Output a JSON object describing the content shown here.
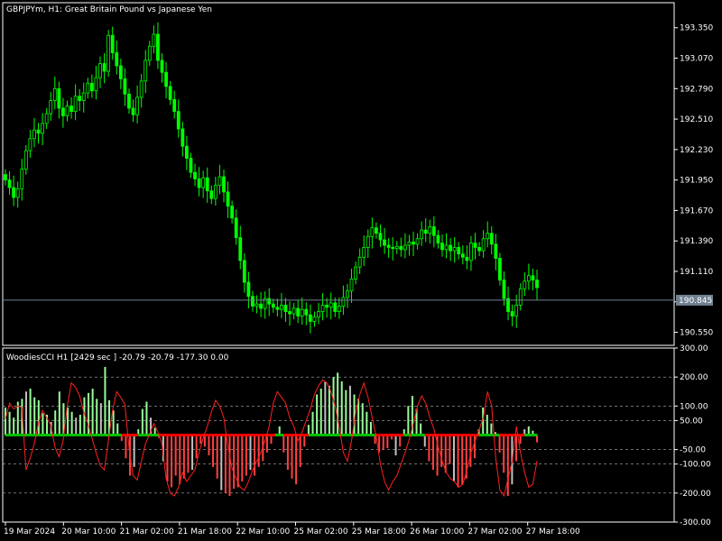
{
  "main_panel": {
    "title": "GBPJPYm, H1:  Great Britain Pound vs Japanese Yen",
    "price_labels": [
      "193.350",
      "193.070",
      "192.790",
      "192.510",
      "192.230",
      "191.950",
      "191.670",
      "191.390",
      "191.110",
      "190.830",
      "190.550"
    ],
    "current_price": "190.845"
  },
  "indicator_panel": {
    "title": "WoodiesCCI H1 [2429 sec ] -20.79 -20.79 -177.30 0.00",
    "level_labels": [
      "300.00",
      "200.00",
      "100.00",
      "50.00",
      "-50.00",
      "-100.00",
      "-200.00",
      "-300.00"
    ]
  },
  "time_axis": {
    "labels": [
      "19 Mar 2024",
      "20 Mar 10:00",
      "21 Mar 02:00",
      "21 Mar 18:00",
      "22 Mar 10:00",
      "25 Mar 02:00",
      "25 Mar 18:00",
      "26 Mar 10:00",
      "27 Mar 02:00",
      "27 Mar 18:00"
    ]
  },
  "colors": {
    "background": "#000000",
    "candle": "#00ff00",
    "axis": "#ffffff",
    "price_line": "#708090",
    "cci_up": "#98fb98",
    "cci_down": "#ff4040",
    "cci_neutral": "#c0c0c0",
    "zero_line_up": "#00c000",
    "zero_line_down": "#ff0000"
  },
  "chart_data": [
    {
      "type": "candlestick",
      "title": "GBPJPYm, H1:  Great Britain Pound vs Japanese Yen",
      "ylim": [
        190.43,
        193.58
      ],
      "current_price": 190.845,
      "close": [
        191.95,
        191.88,
        191.79,
        191.87,
        192.05,
        192.22,
        192.33,
        192.41,
        192.38,
        192.47,
        192.56,
        192.68,
        192.79,
        192.61,
        192.54,
        192.63,
        192.58,
        192.72,
        192.68,
        192.75,
        192.84,
        192.77,
        192.89,
        193.02,
        192.95,
        193.28,
        193.12,
        193.0,
        192.88,
        192.74,
        192.61,
        192.55,
        192.71,
        192.86,
        193.05,
        193.18,
        193.29,
        193.05,
        192.94,
        192.81,
        192.69,
        192.58,
        192.42,
        192.26,
        192.15,
        192.02,
        191.96,
        191.88,
        191.97,
        191.85,
        191.78,
        191.9,
        191.98,
        191.84,
        191.71,
        191.6,
        191.42,
        191.21,
        191.01,
        190.88,
        190.79,
        190.81,
        190.77,
        190.86,
        190.81,
        190.78,
        190.76,
        190.8,
        190.74,
        190.72,
        190.77,
        190.7,
        190.76,
        190.71,
        190.65,
        190.69,
        190.74,
        190.8,
        190.78,
        190.82,
        190.74,
        190.79,
        190.87,
        190.93,
        191.04,
        191.15,
        191.24,
        191.33,
        191.43,
        191.51,
        191.46,
        191.4,
        191.35,
        191.33,
        191.32,
        191.34,
        191.31,
        191.35,
        191.38,
        191.36,
        191.41,
        191.49,
        191.46,
        191.52,
        191.44,
        191.37,
        191.31,
        191.35,
        191.3,
        191.33,
        191.27,
        191.24,
        191.21,
        191.37,
        191.33,
        191.3,
        191.41,
        191.46,
        191.36,
        191.23,
        191.03,
        190.86,
        190.74,
        190.7,
        190.8,
        190.95,
        191.02,
        191.07,
        191.03,
        190.96
      ]
    },
    {
      "type": "bar",
      "title": "WoodiesCCI H1 [2429 sec ] -20.79 -20.79 -177.30 0.00",
      "ylim": [
        -300,
        300
      ],
      "levels": [
        300,
        200,
        100,
        50,
        0,
        -50,
        -100,
        -200,
        -300
      ],
      "values": [
        95,
        80,
        60,
        115,
        125,
        150,
        160,
        130,
        120,
        75,
        70,
        45,
        85,
        150,
        110,
        95,
        80,
        60,
        70,
        130,
        145,
        160,
        125,
        110,
        235,
        120,
        85,
        40,
        -20,
        -80,
        -140,
        -110,
        20,
        90,
        115,
        60,
        25,
        -10,
        -90,
        -160,
        -180,
        -140,
        -170,
        -150,
        -130,
        -120,
        -80,
        -30,
        -40,
        -70,
        -110,
        -150,
        -190,
        -200,
        -210,
        -185,
        -180,
        -160,
        -140,
        -120,
        -140,
        -110,
        -90,
        -60,
        -30,
        5,
        30,
        -60,
        -120,
        -150,
        -170,
        -110,
        -40,
        35,
        80,
        140,
        160,
        185,
        170,
        200,
        215,
        185,
        155,
        170,
        140,
        125,
        110,
        80,
        45,
        -30,
        -60,
        -50,
        -45,
        -15,
        -70,
        -40,
        20,
        100,
        135,
        90,
        40,
        -40,
        -90,
        -120,
        -140,
        -110,
        -130,
        -100,
        -160,
        -180,
        -170,
        -150,
        -110,
        -80,
        20,
        95,
        70,
        40,
        10,
        -60,
        -130,
        -210,
        -170,
        -90,
        -30,
        20,
        30,
        15,
        -25
      ],
      "signal": [
        55,
        110,
        90,
        100,
        95,
        -120,
        -80,
        -30,
        40,
        85,
        60,
        35,
        -40,
        -75,
        -20,
        100,
        180,
        165,
        135,
        80,
        40,
        -10,
        -60,
        -105,
        -120,
        -20,
        85,
        150,
        130,
        105,
        -45,
        -140,
        -155,
        -90,
        -30,
        5,
        40,
        10,
        -30,
        -150,
        -200,
        -210,
        -180,
        -130,
        -160,
        -140,
        -120,
        -60,
        -10,
        30,
        80,
        120,
        100,
        60,
        -40,
        -115,
        -150,
        -180,
        -190,
        -160,
        -120,
        -90,
        -60,
        -20,
        30,
        110,
        150,
        130,
        110,
        60,
        30,
        -20,
        10,
        50,
        90,
        140,
        170,
        190,
        180,
        150,
        100,
        30,
        -60,
        -90,
        -20,
        80,
        140,
        180,
        130,
        60,
        -5,
        -100,
        -160,
        -190,
        -160,
        -140,
        -100,
        -60,
        -15,
        40,
        100,
        135,
        110,
        60,
        20,
        -40,
        -90,
        -130,
        -150,
        -160,
        -180,
        -170,
        -120,
        -60,
        -20,
        20,
        60,
        150,
        100,
        -80,
        -190,
        -210,
        -150,
        -90,
        30,
        -60,
        -130,
        -180,
        -170,
        -90
      ]
    }
  ]
}
